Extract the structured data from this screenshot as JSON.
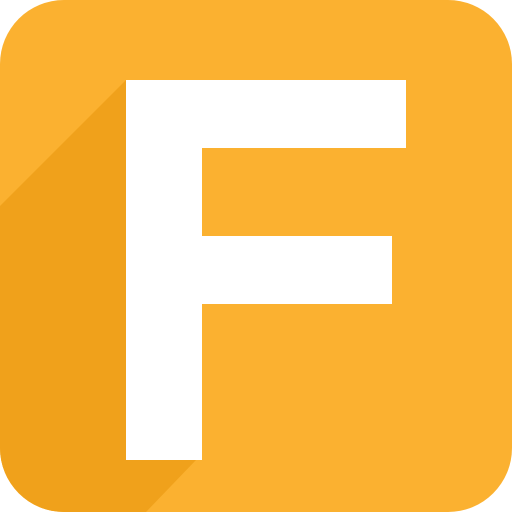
{
  "icon": {
    "name": "letter-f-app-icon",
    "letter": "F",
    "colors": {
      "background": "#FBB130",
      "long_shadow": "#F0A11B",
      "glyph": "#FFFFFF"
    }
  }
}
